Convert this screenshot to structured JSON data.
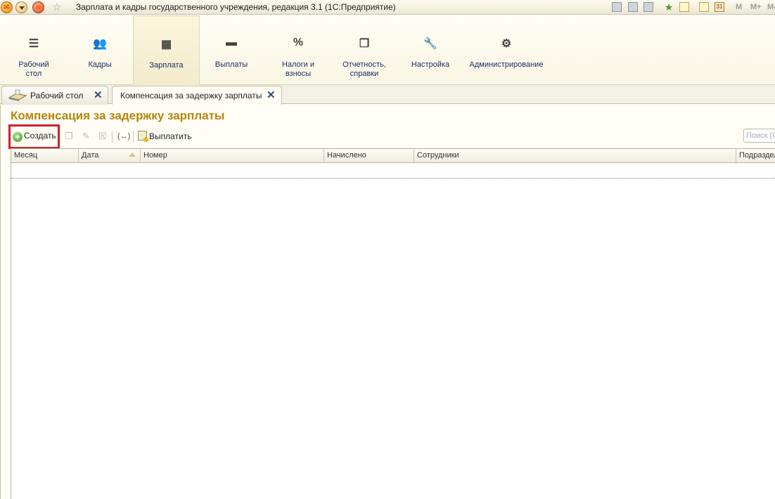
{
  "window": {
    "title": "Зарплата и кадры государственного учреждения, редакция 3.1  (1С:Предприятие)",
    "logo_text": "1С",
    "memory_buttons": [
      "M",
      "M+",
      "M-"
    ]
  },
  "sections": [
    {
      "label": "Рабочий стол",
      "icon": "menu-icon"
    },
    {
      "label": "Кадры",
      "icon": "people-icon"
    },
    {
      "label": "Зарплата",
      "icon": "calculator-icon",
      "active": true
    },
    {
      "label": "Выплаты",
      "icon": "wallet-icon"
    },
    {
      "label": "Налоги и взносы",
      "icon": "percent-icon"
    },
    {
      "label": "Отчетность, справки",
      "icon": "report-icon"
    },
    {
      "label": "Настройка",
      "icon": "wrench-icon"
    },
    {
      "label": "Администрирование",
      "icon": "gear-icon"
    }
  ],
  "tabs": [
    {
      "label": "Рабочий стол",
      "icon": "desktop-icon"
    },
    {
      "label": "Компенсация за задержку зарплаты",
      "active": true
    }
  ],
  "page": {
    "title": "Компенсация за задержку зарплаты"
  },
  "toolbar": {
    "create_label": "Создать",
    "pay_label": "Выплатить",
    "search_placeholder": "Поиск (Ctrl+F)",
    "highlight_color": "#d0202a"
  },
  "table": {
    "columns": [
      "Месяц",
      "Дата",
      "Номер",
      "Начислено",
      "Сотрудники",
      "Подразделение"
    ],
    "sorted_column": "Дата",
    "rows": []
  },
  "colors": {
    "title": "#b5860c",
    "section_label": "#1c2c6c"
  }
}
